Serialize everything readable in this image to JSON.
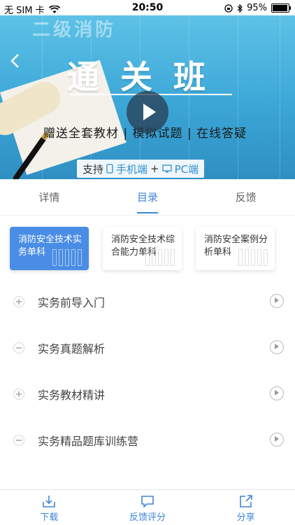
{
  "status_bar": {
    "carrier": "无 SIM 卡",
    "time": "20:50",
    "battery": "95%",
    "battery_level": 0.95
  },
  "banner": {
    "top_text": "二级消防",
    "title": "通关班",
    "subtitle": "赠送全套教材 | 模拟试题 | 在线答疑",
    "support_prefix": "支持",
    "support_mobile": "手机端",
    "support_plus": "+",
    "support_pc": "PC端"
  },
  "tabs": [
    {
      "label": "详情",
      "active": false
    },
    {
      "label": "目录",
      "active": true
    },
    {
      "label": "反馈",
      "active": false
    }
  ],
  "subjects": [
    {
      "label": "消防安全技术实务单科",
      "active": true
    },
    {
      "label": "消防安全技术综合能力单科",
      "active": false
    },
    {
      "label": "消防安全案例分析单科",
      "active": false
    }
  ],
  "chapters": [
    {
      "label": "实务前导入门",
      "expanded": false
    },
    {
      "label": "实务真题解析",
      "expanded": true
    },
    {
      "label": "实务教材精讲",
      "expanded": false
    },
    {
      "label": "实务精品题库训练营",
      "expanded": true
    }
  ],
  "bottom_bar": [
    {
      "label": "下载",
      "icon": "download-icon"
    },
    {
      "label": "反馈评分",
      "icon": "chat-icon"
    },
    {
      "label": "分享",
      "icon": "share-icon"
    }
  ],
  "colors": {
    "accent": "#3f86d8",
    "card_active": "#4a8de4",
    "banner": "#3ba6d7"
  }
}
